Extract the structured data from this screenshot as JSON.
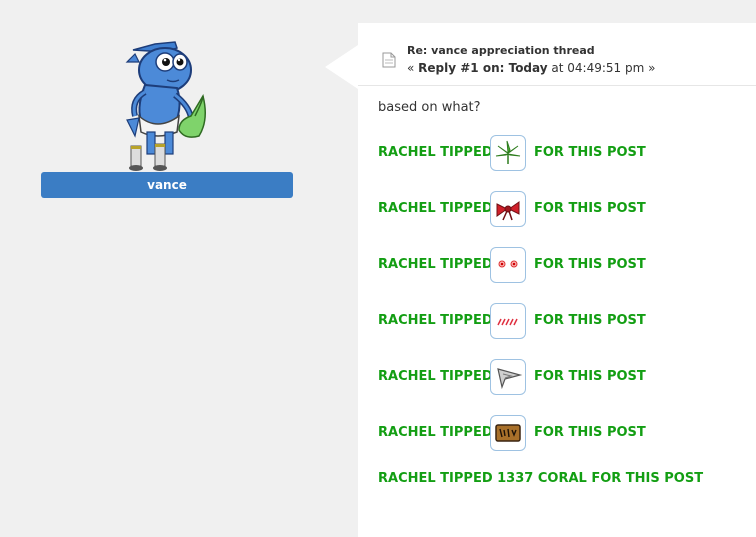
{
  "profile": {
    "username": "vance",
    "avatar": "blue-fish-cartoon-avatar",
    "accent_color": "#3b7dc4"
  },
  "post": {
    "title": "Re: vance appreciation thread",
    "meta_prefix": "«",
    "meta_reply": "Reply #1 on: Today",
    "meta_time": "at 04:49:51 pm",
    "meta_suffix": "»",
    "body": "based on what?",
    "tips": [
      {
        "prefix": "RACHEL TIPPED",
        "icon": "cannabis-leaf-icon",
        "suffix": "FOR THIS POST"
      },
      {
        "prefix": "RACHEL TIPPED",
        "icon": "red-bow-icon",
        "suffix": "FOR THIS POST"
      },
      {
        "prefix": "RACHEL TIPPED",
        "icon": "red-eyes-icon",
        "suffix": "FOR THIS POST"
      },
      {
        "prefix": "RACHEL TIPPED",
        "icon": "red-slashes-icon",
        "suffix": "FOR THIS POST"
      },
      {
        "prefix": "RACHEL TIPPED",
        "icon": "gray-pennant-icon",
        "suffix": "FOR THIS POST"
      },
      {
        "prefix": "RACHEL TIPPED",
        "icon": "brown-sign-icon",
        "suffix": "FOR THIS POST"
      }
    ],
    "coral_tip": "RACHEL TIPPED 1337 CORAL FOR THIS POST",
    "tip_color": "#139e13"
  }
}
